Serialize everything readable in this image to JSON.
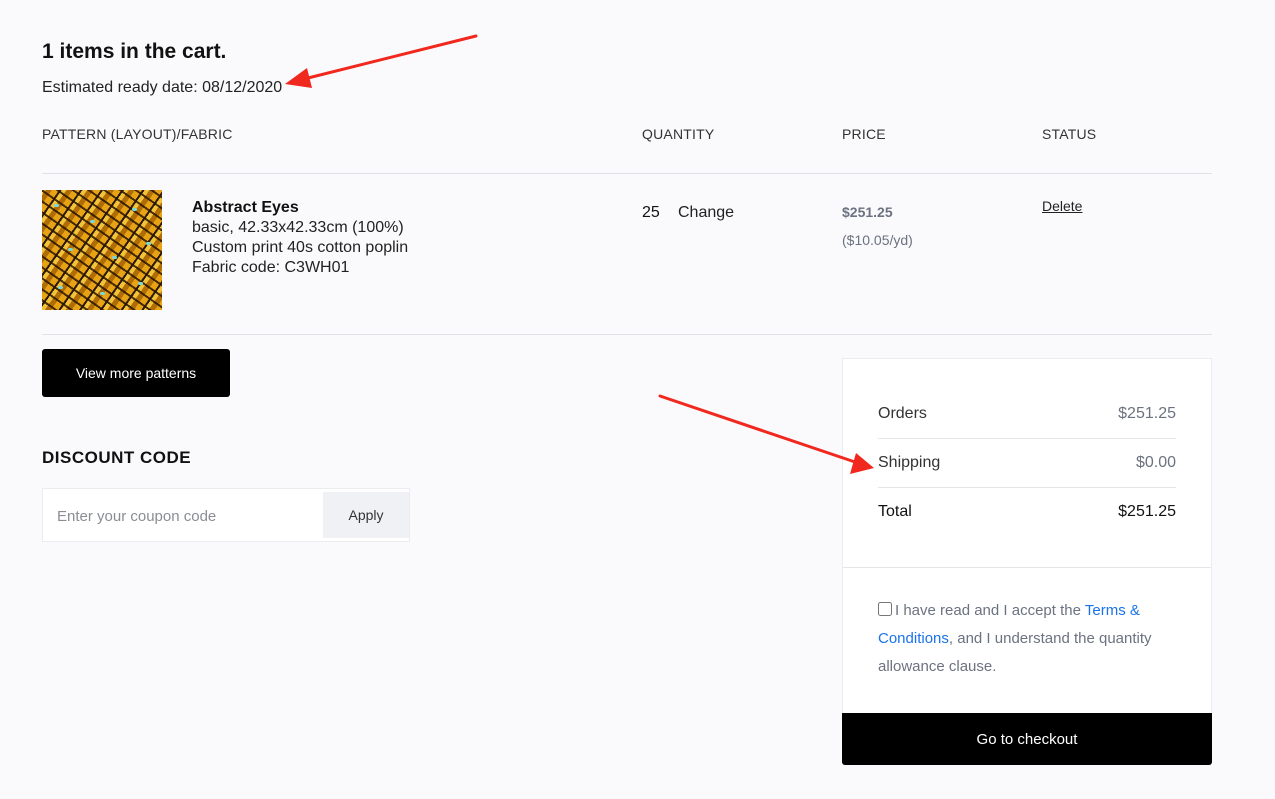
{
  "cart": {
    "title": "1 items in the cart.",
    "ready_date": "Estimated ready date: 08/12/2020"
  },
  "table": {
    "headers": [
      "PATTERN (LAYOUT)/FABRIC",
      "QUANTITY",
      "PRICE",
      "STATUS"
    ],
    "items": [
      {
        "name": "Abstract Eyes",
        "details": [
          "basic, 42.33x42.33cm (100%)",
          "Custom print 40s cotton poplin",
          "Fabric code: C3WH01"
        ],
        "quantity": "25",
        "change_label": "Change",
        "price": "$251.25",
        "unit_price": "($10.05/yd)",
        "delete_label": "Delete"
      }
    ]
  },
  "actions": {
    "view_more": "View more patterns",
    "checkout": "Go to checkout"
  },
  "discount": {
    "title": "DISCOUNT CODE",
    "placeholder": "Enter your coupon code",
    "apply_label": "Apply"
  },
  "summary": {
    "orders_label": "Orders",
    "orders_value": "$251.25",
    "shipping_label": "Shipping",
    "shipping_value": "$0.00",
    "total_label": "Total",
    "total_value": "$251.25"
  },
  "terms": {
    "before": "I have read and I accept the ",
    "link": "Terms & Conditions",
    "after": ", and I understand the quantity allowance clause.",
    "checked": false
  },
  "colors": {
    "annotation_arrow": "#f0281e",
    "link": "#1a73e8"
  }
}
